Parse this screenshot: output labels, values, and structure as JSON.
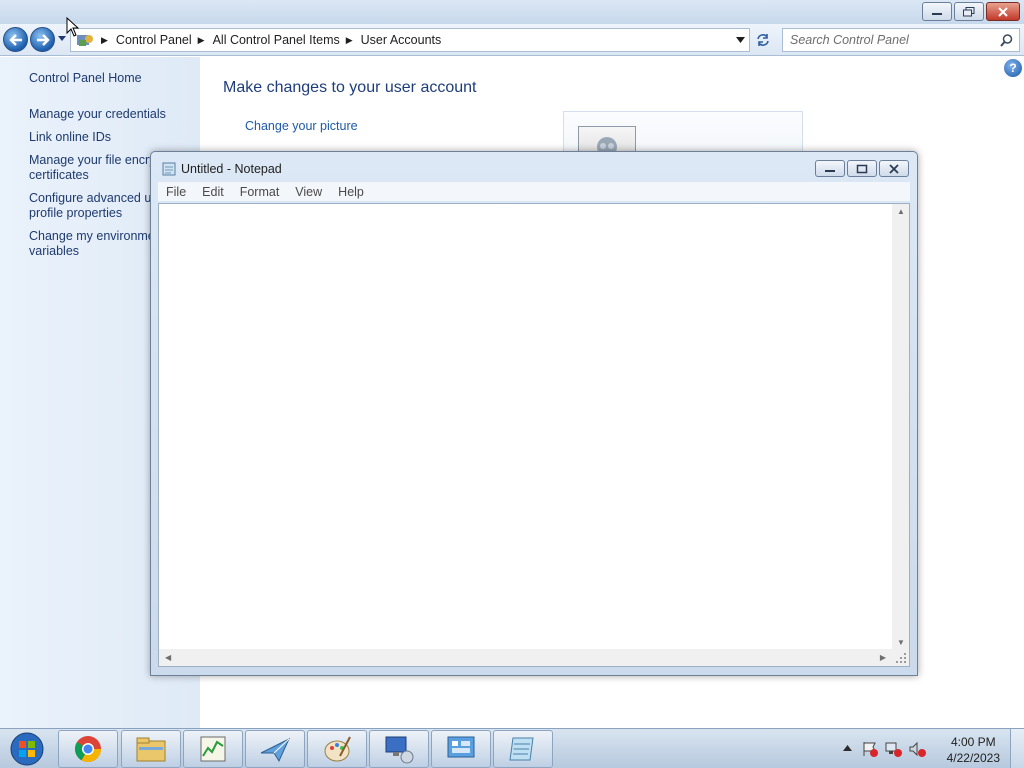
{
  "control_panel": {
    "breadcrumb": [
      "Control Panel",
      "All Control Panel Items",
      "User Accounts"
    ],
    "search_placeholder": "Search Control Panel",
    "sidebar": {
      "home": "Control Panel Home",
      "items": [
        "Manage your credentials",
        "Link online IDs",
        "Manage your file encryption certificates",
        "Configure advanced user profile properties",
        "Change my environment variables"
      ]
    },
    "main": {
      "title": "Make changes to your user account",
      "change_picture": "Change your picture"
    }
  },
  "notepad": {
    "title": "Untitled - Notepad",
    "menu": [
      "File",
      "Edit",
      "Format",
      "View",
      "Help"
    ],
    "content": ""
  },
  "taskbar": {
    "apps": [
      "chrome-icon",
      "file-explorer-icon",
      "task-manager-icon",
      "mail-client-icon",
      "paint-icon",
      "remote-desktop-icon",
      "control-panel-icon",
      "notepad-icon"
    ],
    "time": "4:00 PM",
    "date": "4/22/2023"
  },
  "colors": {
    "link_blue": "#1e5aa8",
    "title_blue": "#1e3d7a",
    "sidebar_bg": "#e4eef9",
    "close_red": "#c2392a"
  }
}
